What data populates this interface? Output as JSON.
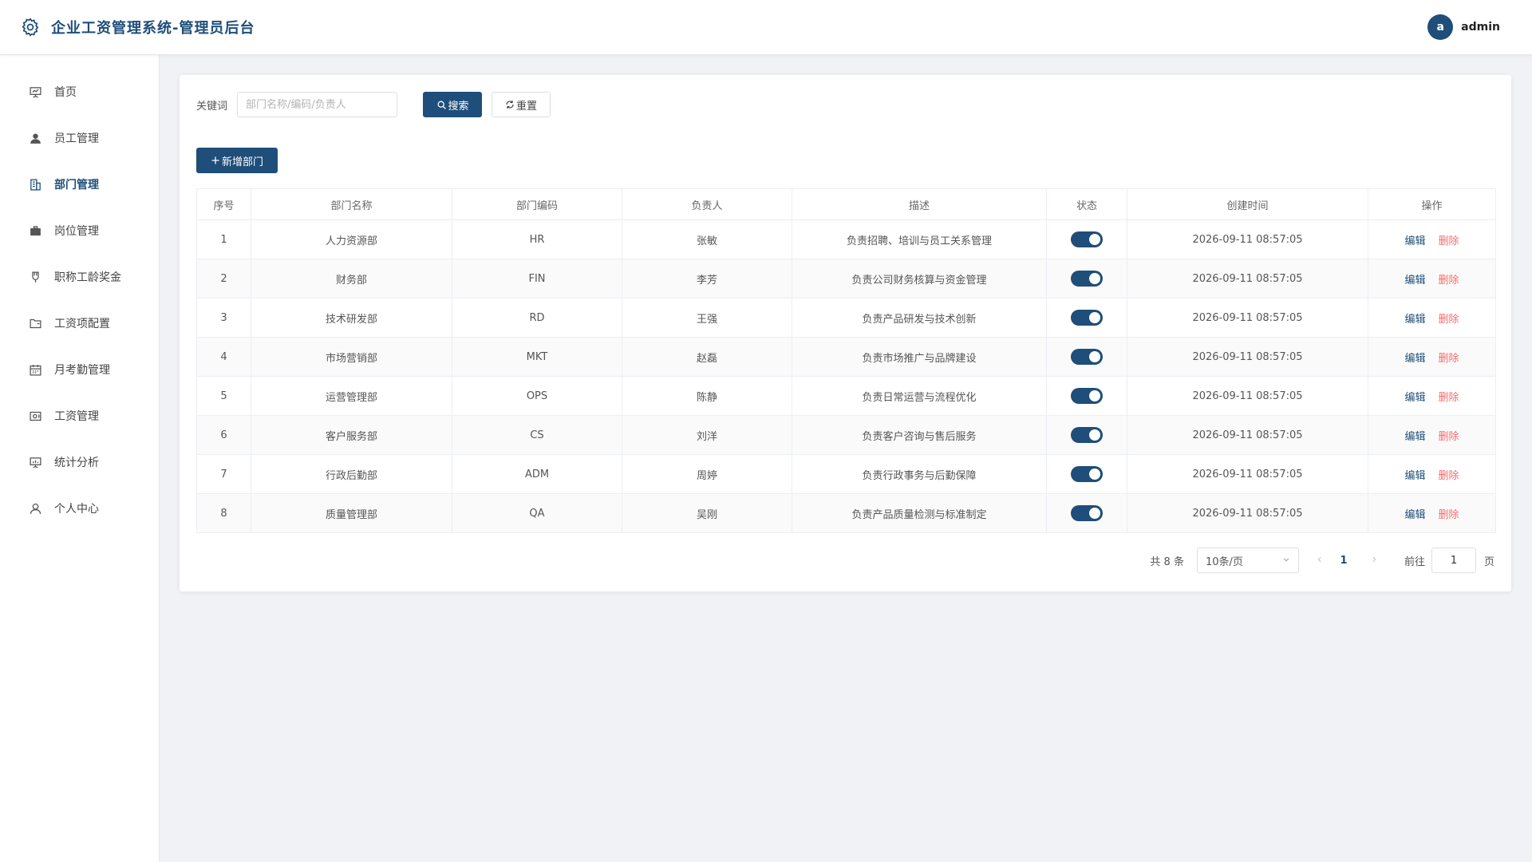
{
  "header": {
    "title": "企业工资管理系统-管理员后台",
    "avatar_letter": "a",
    "username": "admin",
    "logo_icon": "gear-icon"
  },
  "sidebar": {
    "items": [
      {
        "label": "首页",
        "icon": "presentation-icon",
        "active": false
      },
      {
        "label": "员工管理",
        "icon": "user-icon",
        "active": false
      },
      {
        "label": "部门管理",
        "icon": "building-icon",
        "active": true
      },
      {
        "label": "岗位管理",
        "icon": "briefcase-icon",
        "active": false
      },
      {
        "label": "职称工龄奖金",
        "icon": "medal-icon",
        "active": false
      },
      {
        "label": "工资项配置",
        "icon": "folder-icon",
        "active": false
      },
      {
        "label": "月考勤管理",
        "icon": "calendar-icon",
        "active": false
      },
      {
        "label": "工资管理",
        "icon": "money-icon",
        "active": false
      },
      {
        "label": "统计分析",
        "icon": "chart-icon",
        "active": false
      },
      {
        "label": "个人中心",
        "icon": "person-icon",
        "active": false
      }
    ]
  },
  "filter": {
    "keyword_label": "关键词",
    "keyword_value": "",
    "keyword_placeholder": "部门名称/编码/负责人",
    "search_label": "搜索",
    "reset_label": "重置"
  },
  "actions": {
    "add_label": "新增部门"
  },
  "table": {
    "columns": [
      "序号",
      "部门名称",
      "部门编码",
      "负责人",
      "描述",
      "状态",
      "创建时间",
      "操作"
    ],
    "rows": [
      {
        "index": "1",
        "name": "人力资源部",
        "code": "HR",
        "manager": "张敏",
        "desc": "负责招聘、培训与员工关系管理",
        "enabled": true,
        "created": "2026-09-11 08:57:05"
      },
      {
        "index": "2",
        "name": "财务部",
        "code": "FIN",
        "manager": "李芳",
        "desc": "负责公司财务核算与资金管理",
        "enabled": true,
        "created": "2026-09-11 08:57:05"
      },
      {
        "index": "3",
        "name": "技术研发部",
        "code": "RD",
        "manager": "王强",
        "desc": "负责产品研发与技术创新",
        "enabled": true,
        "created": "2026-09-11 08:57:05"
      },
      {
        "index": "4",
        "name": "市场营销部",
        "code": "MKT",
        "manager": "赵磊",
        "desc": "负责市场推广与品牌建设",
        "enabled": true,
        "created": "2026-09-11 08:57:05"
      },
      {
        "index": "5",
        "name": "运营管理部",
        "code": "OPS",
        "manager": "陈静",
        "desc": "负责日常运营与流程优化",
        "enabled": true,
        "created": "2026-09-11 08:57:05"
      },
      {
        "index": "6",
        "name": "客户服务部",
        "code": "CS",
        "manager": "刘洋",
        "desc": "负责客户咨询与售后服务",
        "enabled": true,
        "created": "2026-09-11 08:57:05"
      },
      {
        "index": "7",
        "name": "行政后勤部",
        "code": "ADM",
        "manager": "周婷",
        "desc": "负责行政事务与后勤保障",
        "enabled": true,
        "created": "2026-09-11 08:57:05"
      },
      {
        "index": "8",
        "name": "质量管理部",
        "code": "QA",
        "manager": "吴刚",
        "desc": "负责产品质量检测与标准制定",
        "enabled": true,
        "created": "2026-09-11 08:57:05"
      }
    ],
    "edit_label": "编辑",
    "delete_label": "删除"
  },
  "pagination": {
    "total_text": "共 8 条",
    "page_size": "10条/页",
    "current_page": "1",
    "goto_label": "前往",
    "goto_value": "1",
    "page_unit": "页"
  },
  "colors": {
    "primary": "#1e4e79",
    "danger": "#f56c6c",
    "background": "#f0f2f5"
  }
}
